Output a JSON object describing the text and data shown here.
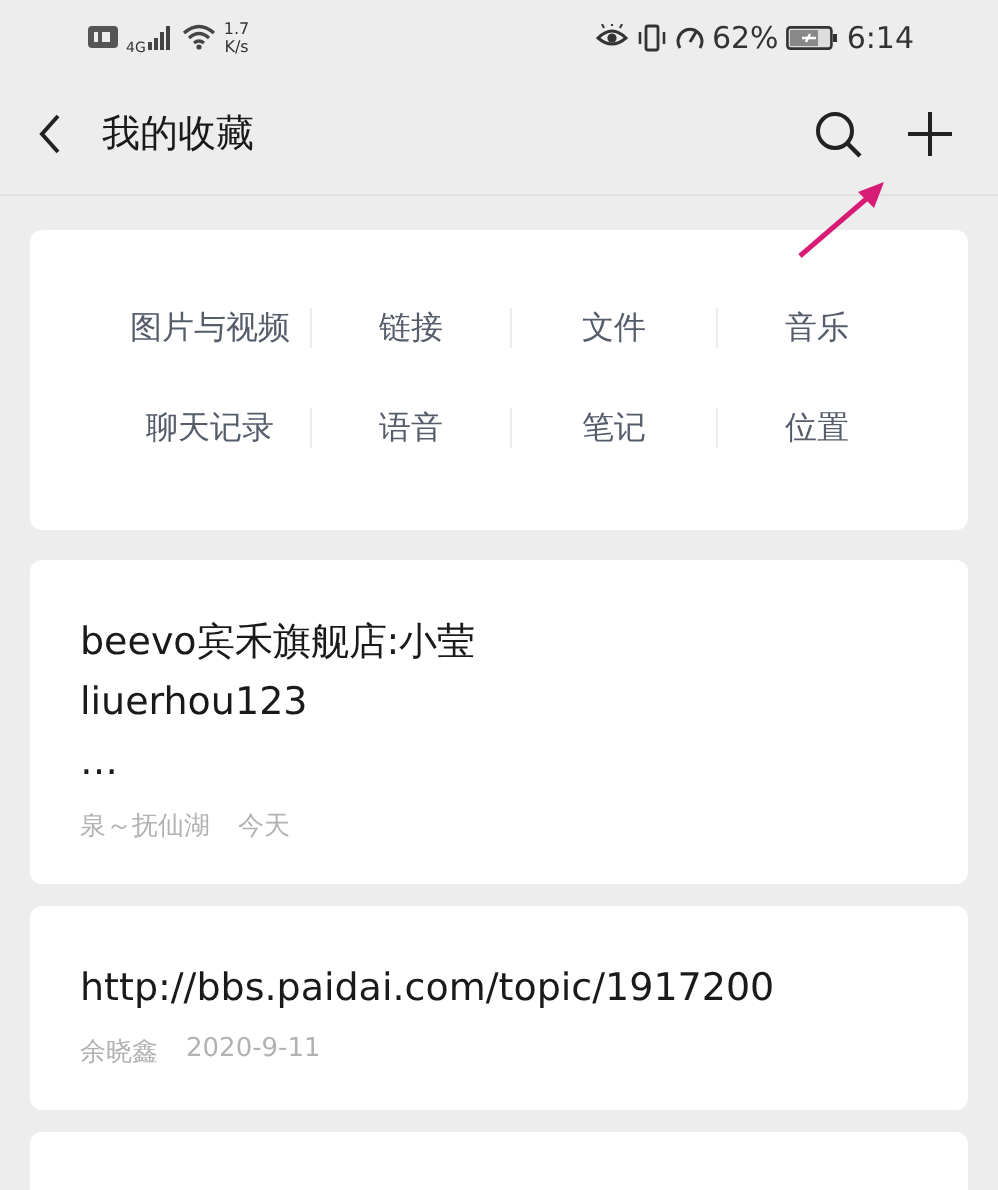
{
  "status_bar": {
    "network": "4G",
    "speed": "1.7",
    "speed_unit": "K/s",
    "battery": "62%",
    "time": "6:14"
  },
  "header": {
    "title": "我的收藏"
  },
  "categories": [
    [
      "图片与视频",
      "链接",
      "文件",
      "音乐"
    ],
    [
      "聊天记录",
      "语音",
      "笔记",
      "位置"
    ]
  ],
  "favorites": [
    {
      "lines": [
        "beevo宾禾旗舰店:小莹",
        "liuerhou123",
        "…"
      ],
      "source": "泉～抚仙湖",
      "date": "今天"
    },
    {
      "lines": [
        "http://bbs.paidai.com/topic/1917200"
      ],
      "source": "余晓鑫",
      "date": "2020-9-11"
    }
  ]
}
